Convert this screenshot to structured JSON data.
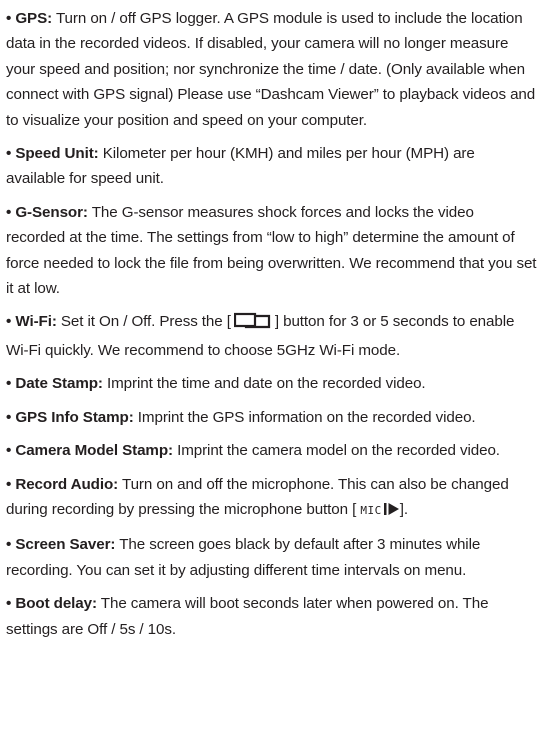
{
  "bullet": "•",
  "items": [
    {
      "term": "GPS:",
      "text": "Turn on / off GPS logger. A GPS module is used to include the location data in the recorded videos. If disabled, your camera will no longer measure your speed and position; nor synchronize the time / date. (Only available when connect with GPS signal) Please use “Dashcam Viewer” to playback videos and to visualize your position and speed on your computer."
    },
    {
      "term": "Speed Unit:",
      "text": "Kilometer per hour (KMH) and miles per hour (MPH) are available for speed unit."
    },
    {
      "term": "G-Sensor:",
      "text": "The G-sensor measures shock forces and locks the video recorded at the time. The settings from “low to high” determine the amount of force needed to lock the file from being overwritten. We recommend that you set it at low."
    },
    {
      "term": "Wi-Fi:",
      "text_before": "Set it On / Off. Press the [",
      "icon": "dual-screen-icon",
      "text_after": "] button for 3 or 5 seconds to enable Wi-Fi quickly. We recommend to choose 5GHz Wi-Fi mode."
    },
    {
      "term": "Date Stamp:",
      "text": "Imprint the time and date on the recorded video."
    },
    {
      "term": "GPS Info Stamp:",
      "text": "Imprint the GPS information on the recorded video."
    },
    {
      "term": "Camera Model Stamp:",
      "text": "Imprint the camera model on the recorded video."
    },
    {
      "term": "Record Audio:",
      "text_before": "Turn on and off the microphone. This can also be changed during recording by pressing the microphone button [",
      "mic_label": "MIC",
      "icon": "play-icon",
      "text_after": "]."
    },
    {
      "term": "Screen Saver:",
      "text": "The screen goes black by default after 3 minutes while recording. You can set it by adjusting different time intervals on menu."
    },
    {
      "term": "Boot delay:",
      "text": "The camera will boot seconds later when powered on. The settings are Off / 5s / 10s."
    }
  ]
}
